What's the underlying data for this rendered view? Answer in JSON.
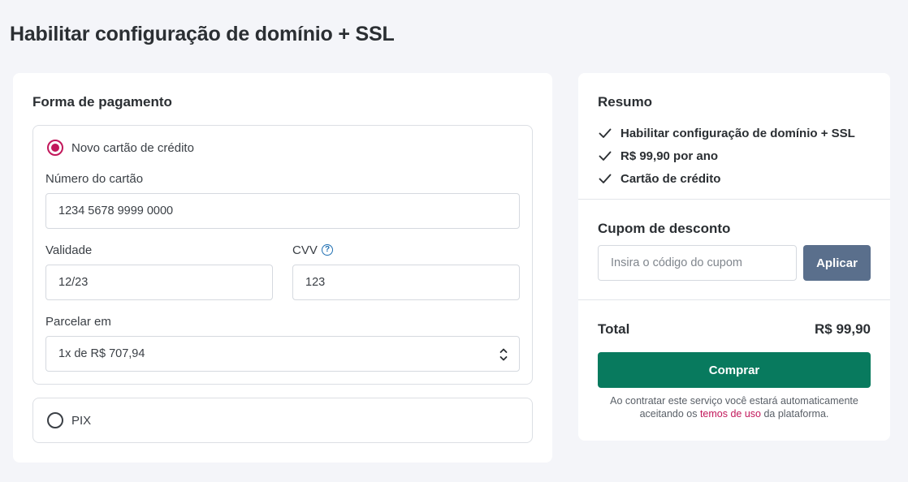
{
  "page": {
    "title": "Habilitar configuração de domínio + SSL"
  },
  "payment": {
    "section_title": "Forma de pagamento",
    "methods": {
      "card": {
        "label": "Novo cartão de crédito",
        "selected": true,
        "card_number": {
          "label": "Número do cartão",
          "value": "1234 5678 9999 0000"
        },
        "expiry": {
          "label": "Validade",
          "value": "12/23"
        },
        "cvv": {
          "label": "CVV",
          "value": "123",
          "help_icon": "question-circle-icon"
        },
        "installments": {
          "label": "Parcelar em",
          "value": "1x de R$ 707,94"
        }
      },
      "pix": {
        "label": "PIX",
        "selected": false
      }
    }
  },
  "summary": {
    "section_title": "Resumo",
    "items": [
      {
        "icon": "check-icon",
        "text": "Habilitar configuração de domínio + SSL"
      },
      {
        "icon": "check-icon",
        "text": "R$ 99,90 por ano"
      },
      {
        "icon": "check-icon",
        "text": "Cartão de crédito"
      }
    ],
    "coupon": {
      "title": "Cupom de desconto",
      "placeholder": "Insira o código do cupom",
      "apply_label": "Aplicar"
    },
    "total": {
      "label": "Total",
      "value": "R$ 99,90"
    },
    "buy_label": "Comprar",
    "terms": {
      "before": "Ao contratar este serviço você estará automaticamente aceitando os ",
      "link": "temos de uso",
      "after": " da plataforma."
    }
  },
  "colors": {
    "accent": "#c2185b",
    "primary_button": "#087a5e",
    "secondary_button": "#5a6f8c",
    "help_icon": "#1f6fb2",
    "background": "#f4f5f9"
  }
}
